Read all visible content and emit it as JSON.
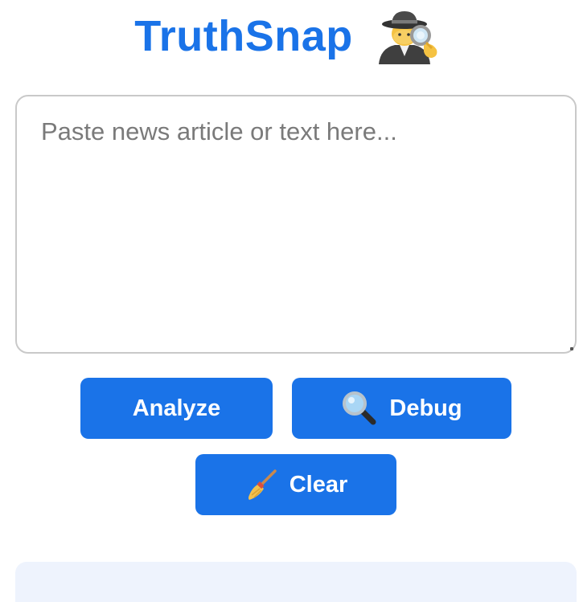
{
  "header": {
    "title": "TruthSnap",
    "icon": "detective-icon"
  },
  "input": {
    "placeholder": "Paste news article or text here...",
    "value": ""
  },
  "buttons": {
    "analyze": {
      "label": "Analyze"
    },
    "debug": {
      "label": "Debug",
      "icon": "magnifying-glass-icon"
    },
    "clear": {
      "label": "Clear",
      "icon": "broom-icon"
    }
  },
  "colors": {
    "accent": "#1a73e8",
    "result_panel": "#eef3fd",
    "border": "#c9c9c9"
  }
}
